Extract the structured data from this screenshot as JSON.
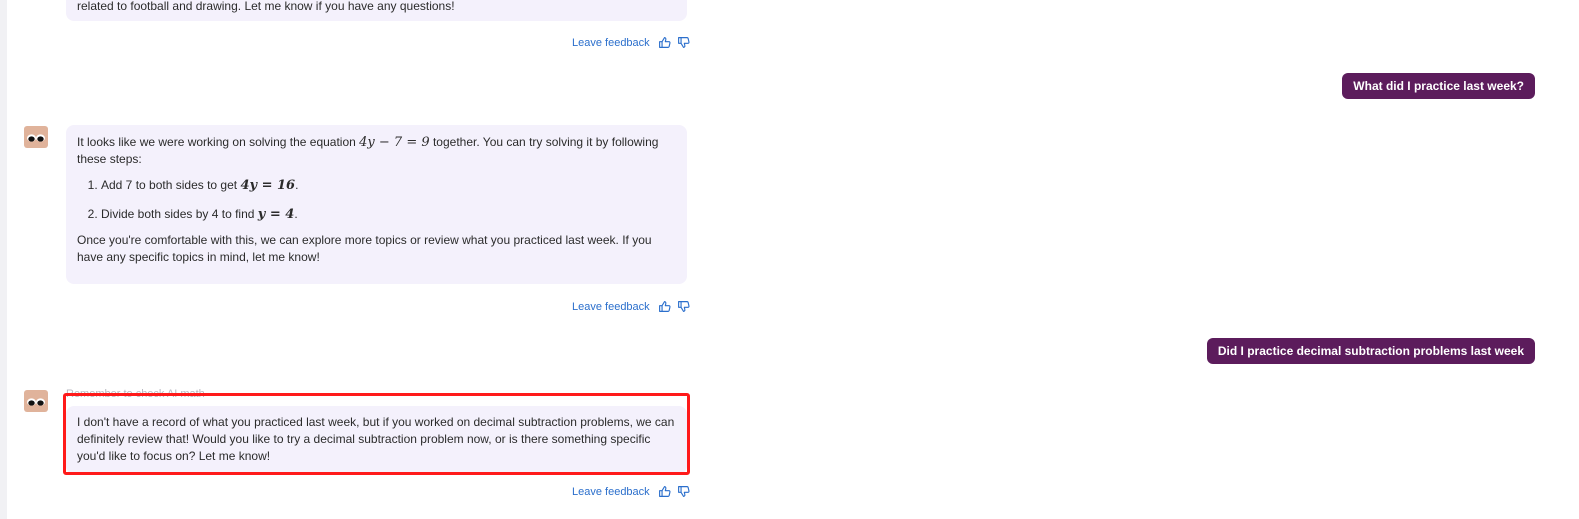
{
  "messages": {
    "top_partial": "related to football and drawing. Let me know if you have any questions!",
    "user1": "What did I practice last week?",
    "assistant1": {
      "intro_a": "It looks like we were working on solving the equation ",
      "intro_eq": "4y − 7 = 9",
      "intro_b": " together. You can try solving it by following these steps:",
      "step1_a": "Add 7 to both sides to get ",
      "step1_eq": "4y = 16",
      "step2_a": "Divide both sides by 4 to find ",
      "step2_eq": "y = 4",
      "outro": "Once you're comfortable with this, we can explore more topics or review what you practiced last week. If you have any specific topics in mind, let me know!"
    },
    "user2": "Did I practice decimal subtraction problems last week",
    "disclaimer": "Remember to check AI math",
    "assistant2": "I don't have a record of what you practiced last week, but if you worked on decimal subtraction problems, we can definitely review that! Would you like to try a decimal subtraction problem now, or is there something specific you'd like to focus on? Let me know!"
  },
  "feedback": {
    "label": "Leave feedback"
  },
  "icons": {
    "thumbs_up": "thumbs-up-icon",
    "thumbs_down": "thumbs-down-icon",
    "avatar": "bot-eyes-avatar"
  },
  "colors": {
    "assistant_bubble": "#f4f1fc",
    "user_bubble": "#5c1c5c",
    "link": "#2b6fcc",
    "highlight": "#ff1a1a",
    "avatar": "#e0b39b"
  }
}
